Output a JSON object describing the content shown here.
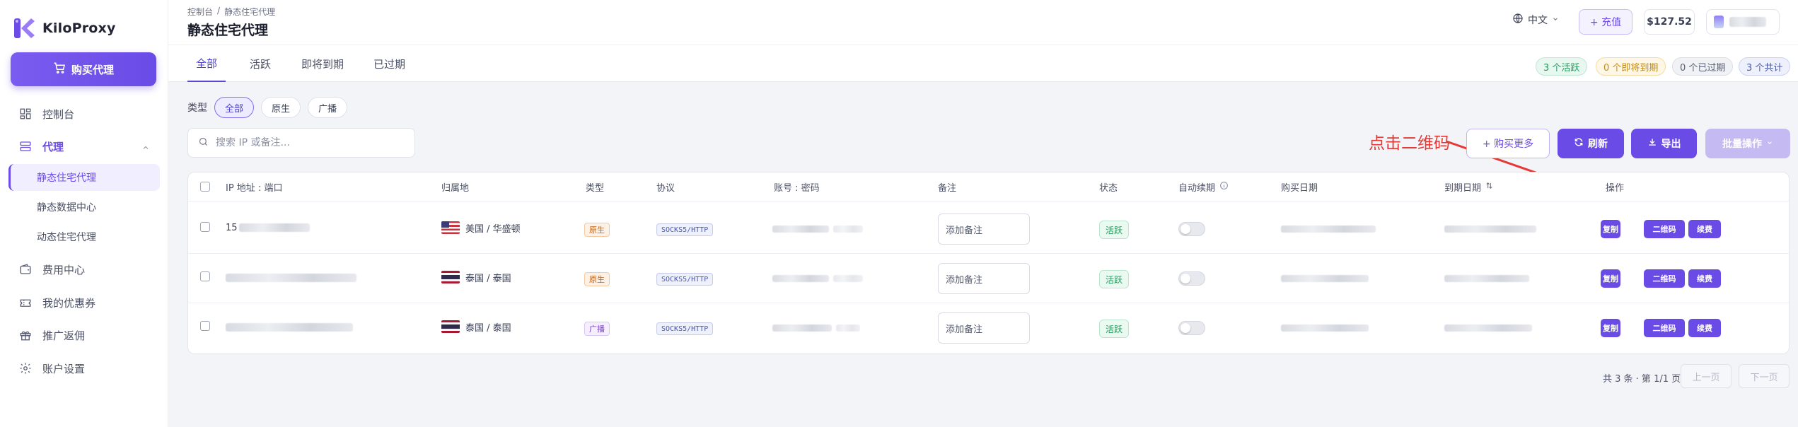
{
  "brand": {
    "name": "KiloProxy"
  },
  "sidebar": {
    "buy_button": "购买代理",
    "items": [
      {
        "label": "控制台",
        "icon": "dashboard-icon"
      },
      {
        "label": "代理",
        "icon": "proxy-icon"
      },
      {
        "label": "费用中心",
        "icon": "wallet-icon"
      },
      {
        "label": "我的优惠券",
        "icon": "ticket-icon"
      },
      {
        "label": "推广返佣",
        "icon": "gift-icon"
      },
      {
        "label": "账户设置",
        "icon": "gear-icon"
      }
    ],
    "sub_items": [
      {
        "label": "静态住宅代理"
      },
      {
        "label": "静态数据中心"
      },
      {
        "label": "动态住宅代理"
      }
    ]
  },
  "header": {
    "breadcrumb": [
      "控制台",
      "/",
      "静态住宅代理"
    ],
    "title": "静态住宅代理",
    "language": "中文",
    "recharge": "+ 充值",
    "balance": "$127.52"
  },
  "tabs": [
    {
      "label": "全部"
    },
    {
      "label": "活跃"
    },
    {
      "label": "即将到期"
    },
    {
      "label": "已过期"
    }
  ],
  "summary": [
    {
      "label": "3 个活跃"
    },
    {
      "label": "0 个即将到期"
    },
    {
      "label": "0 个已过期"
    },
    {
      "label": "3 个共计"
    }
  ],
  "filter": {
    "label": "类型",
    "chips": [
      "全部",
      "原生",
      "广播"
    ]
  },
  "search": {
    "placeholder": "搜索 IP 或备注..."
  },
  "annotation": "点击二维码",
  "toolbar": {
    "buy_more": "+ 购买更多",
    "refresh": "刷新",
    "export": "导出",
    "batch": "批量操作"
  },
  "table": {
    "columns": [
      "IP 地址 : 端口",
      "归属地",
      "类型",
      "协议",
      "账号 : 密码",
      "备注",
      "状态",
      "自动续期",
      "购买日期",
      "到期日期",
      "操作"
    ],
    "rows": [
      {
        "ip_prefix": "15",
        "location": "美国 / 华盛顿",
        "flag": "us",
        "type": "原生",
        "protocol": "SOCKS5/HTTP",
        "note_placeholder": "添加备注",
        "status": "活跃"
      },
      {
        "ip_prefix": "",
        "location": "泰国 / 泰国",
        "flag": "th",
        "type": "原生",
        "protocol": "SOCKS5/HTTP",
        "note_placeholder": "添加备注",
        "status": "活跃"
      },
      {
        "ip_prefix": "",
        "location": "泰国 / 泰国",
        "flag": "th",
        "type": "广播",
        "protocol": "SOCKS5/HTTP",
        "note_placeholder": "添加备注",
        "status": "活跃"
      }
    ],
    "actions": [
      "复制",
      "二维码",
      "续费"
    ]
  },
  "pagination": {
    "summary": "共 3 条 · 第 1/1 页",
    "prev": "上一页",
    "next": "下一页"
  },
  "colors": {
    "accent": "#6a4be6",
    "annotation": "#e53935",
    "active_status": "#1e9a5a"
  }
}
